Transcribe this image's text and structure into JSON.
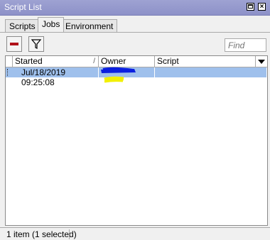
{
  "window": {
    "title": "Script List"
  },
  "tabs": [
    {
      "label": "Scripts",
      "active": false
    },
    {
      "label": "Jobs",
      "active": true
    },
    {
      "label": "Environment",
      "active": false
    }
  ],
  "toolbar": {
    "remove_icon": "minus-icon",
    "filter_icon": "funnel-icon",
    "find_placeholder": "Find"
  },
  "table": {
    "columns": [
      "Started",
      "Owner",
      "Script"
    ],
    "sort_indicator": "/",
    "rows": [
      {
        "started": "Jul/18/2019 09:25:08",
        "owner": "",
        "script": "",
        "selected": true
      }
    ]
  },
  "status": {
    "text": "1 item (1 selected)"
  },
  "colors": {
    "titlebar": "#9ea2d2",
    "selected_row": "#9fc0ec",
    "redaction_blue": "#0b1fe0",
    "highlight_yellow": "#f2f000",
    "remove_red": "#b0111a"
  }
}
